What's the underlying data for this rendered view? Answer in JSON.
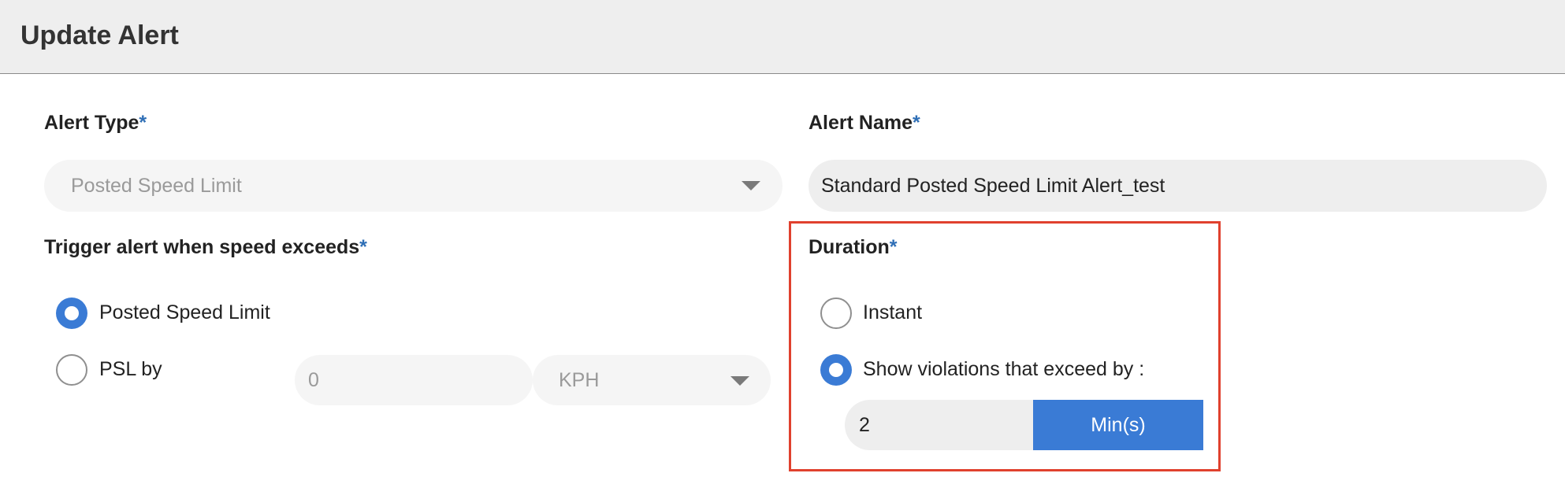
{
  "header": {
    "title": "Update Alert"
  },
  "alert_type": {
    "label": "Alert Type",
    "required_mark": "*",
    "value": "Posted Speed Limit",
    "caret_icon": "chevron-down-icon"
  },
  "alert_name": {
    "label": "Alert Name",
    "required_mark": "*",
    "value": "Standard Posted Speed Limit Alert_test"
  },
  "trigger": {
    "label": "Trigger alert when speed exceeds",
    "required_mark": "*",
    "options": [
      {
        "label": "Posted Speed Limit",
        "checked": true
      },
      {
        "label": "PSL by",
        "checked": false
      }
    ],
    "psl_value": "0",
    "psl_unit": "KPH"
  },
  "duration": {
    "label": "Duration",
    "required_mark": "*",
    "options": [
      {
        "label": "Instant",
        "checked": false
      },
      {
        "label": "Show violations that exceed by :",
        "checked": true
      }
    ],
    "value": "2",
    "unit_button": "Min(s)"
  },
  "colors": {
    "accent": "#3a7bd5",
    "required": "#2f6fb6",
    "highlight_border": "#e0412e"
  }
}
